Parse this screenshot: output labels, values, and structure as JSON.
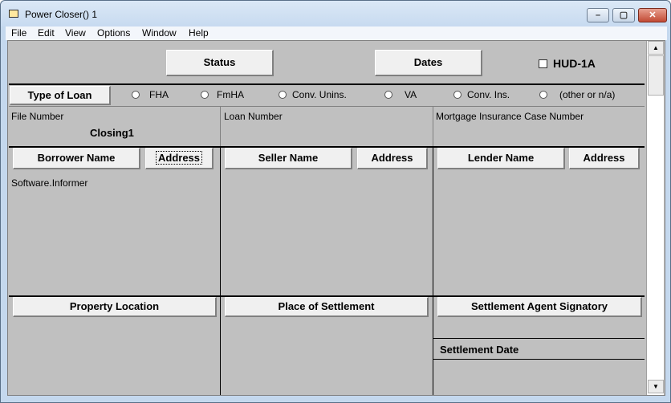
{
  "window": {
    "title": "Power Closer()  1",
    "controls": {
      "minimize": "–",
      "maximize": "▢",
      "close": "✕"
    }
  },
  "menubar": [
    "File",
    "Edit",
    "View",
    "Options",
    "Window",
    "Help"
  ],
  "toolbar": {
    "status_label": "Status",
    "dates_label": "Dates",
    "hud1a_label": "HUD-1A",
    "hud1a_checked": false
  },
  "loan_type": {
    "button_label": "Type of Loan",
    "options": [
      "FHA",
      "FmHA",
      "Conv. Unins.",
      "VA",
      "Conv. Ins.",
      "(other or n/a)"
    ],
    "selected": null
  },
  "fields": {
    "file_number_label": "File Number",
    "file_number_value": "Closing1",
    "loan_number_label": "Loan Number",
    "loan_number_value": "",
    "mortgage_case_label": "Mortgage Insurance Case Number",
    "mortgage_case_value": ""
  },
  "parties": {
    "borrower_button": "Borrower Name",
    "borrower_address_button": "Address",
    "borrower_value": "Software.Informer",
    "seller_button": "Seller Name",
    "seller_address_button": "Address",
    "lender_button": "Lender Name",
    "lender_address_button": "Address"
  },
  "settlement": {
    "property_location_button": "Property Location",
    "place_of_settlement_button": "Place of Settlement",
    "agent_signatory_button": "Settlement Agent Signatory",
    "settlement_date_label": "Settlement Date"
  },
  "scrollbar": {
    "up": "▲",
    "down": "▼"
  }
}
